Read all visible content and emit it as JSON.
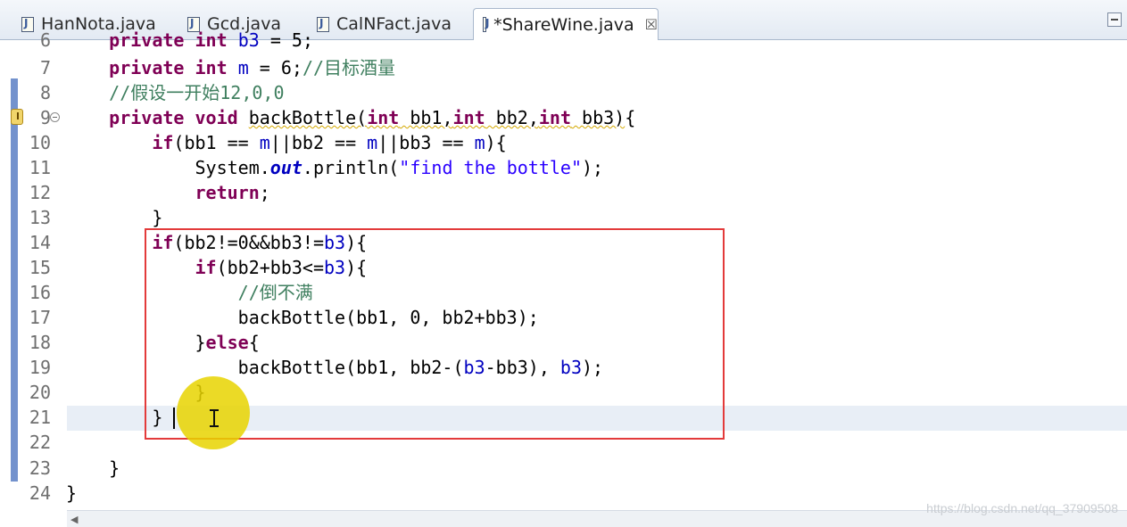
{
  "tabs": [
    {
      "label": "HanNota.java",
      "active": false
    },
    {
      "label": "Gcd.java",
      "active": false
    },
    {
      "label": "CalNFact.java",
      "active": false
    },
    {
      "label": "*ShareWine.java",
      "active": true
    }
  ],
  "tab_close_glyph": "☒",
  "editor": {
    "lines": [
      {
        "n": "6",
        "text": "    private int b3 = 5;"
      },
      {
        "n": "7",
        "text": "    private int m = 6;//目标酒量"
      },
      {
        "n": "8",
        "text": "    //假设一开始12,0,0"
      },
      {
        "n": "9",
        "text": "    private void backBottle(int bb1,int bb2,int bb3){"
      },
      {
        "n": "10",
        "text": "        if(bb1 == m||bb2 == m||bb3 == m){"
      },
      {
        "n": "11",
        "text": "            System.out.println(\"find the bottle\");"
      },
      {
        "n": "12",
        "text": "            return;"
      },
      {
        "n": "13",
        "text": "        }"
      },
      {
        "n": "14",
        "text": "        if(bb2!=0&&bb3!=b3){"
      },
      {
        "n": "15",
        "text": "            if(bb2+bb3<=b3){"
      },
      {
        "n": "16",
        "text": "                //倒不满"
      },
      {
        "n": "17",
        "text": "                backBottle(bb1, 0, bb2+bb3);"
      },
      {
        "n": "18",
        "text": "            }else{"
      },
      {
        "n": "19",
        "text": "                backBottle(bb1, bb2-(b3-bb3), b3);"
      },
      {
        "n": "20",
        "text": "            }"
      },
      {
        "n": "21",
        "text": "        }"
      },
      {
        "n": "22",
        "text": ""
      },
      {
        "n": "23",
        "text": "    }"
      },
      {
        "n": "24",
        "text": "}"
      }
    ],
    "current_line": "21"
  },
  "watermark": "https://blog.csdn.net/qq_37909508",
  "icons": {
    "tab_file": "java-file-icon",
    "close": "close-icon",
    "minimize": "minimize-icon",
    "warning": "lightbulb-warning-icon",
    "fold": "fold-collapse-icon"
  },
  "colors": {
    "keyword": "#7f0055",
    "comment": "#3f7f5f",
    "string": "#2a00ff",
    "field": "#0000c0",
    "annotation_box": "#e33b3b",
    "pointer_highlight": "#e8d400"
  }
}
